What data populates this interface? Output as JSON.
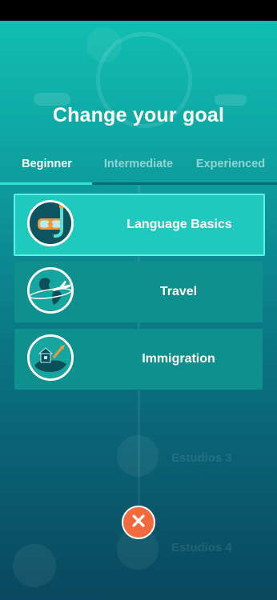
{
  "title": "Change your goal",
  "tabs": [
    {
      "label": "Beginner",
      "active": true
    },
    {
      "label": "Intermediate",
      "active": false
    },
    {
      "label": "Experienced",
      "active": false
    }
  ],
  "goals": [
    {
      "label": "Language Basics",
      "icon": "snorkel-mask-icon",
      "selected": true
    },
    {
      "label": "Travel",
      "icon": "globe-airplane-icon",
      "selected": false
    },
    {
      "label": "Immigration",
      "icon": "house-on-island-icon",
      "selected": false
    }
  ],
  "background_hints": [
    "Estudios 3",
    "Estudios 4"
  ],
  "close_icon": "close-icon",
  "colors": {
    "selected_card": "#20c9bd",
    "card": "#0f8f8d",
    "tab_indicator": "#2ee6d4",
    "close_button": "#f26a3d"
  }
}
